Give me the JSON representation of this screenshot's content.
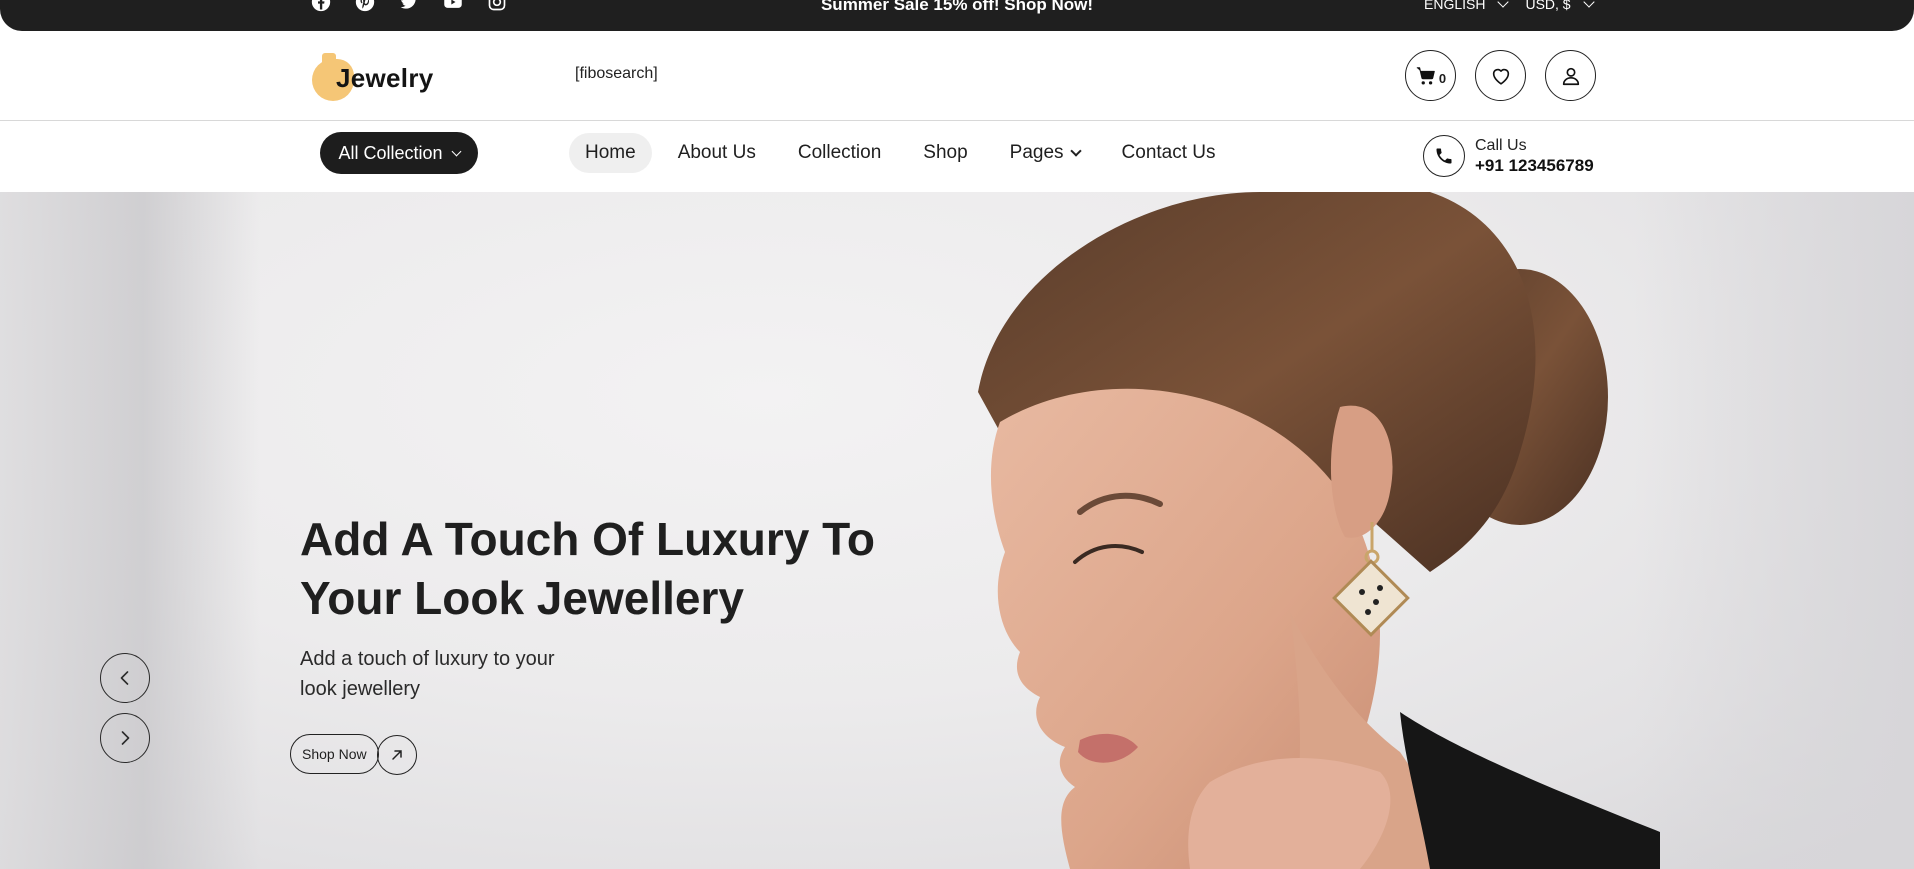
{
  "topbar": {
    "social_icons": [
      "facebook-icon",
      "pinterest-icon",
      "twitter-icon",
      "youtube-icon",
      "instagram-icon"
    ],
    "promo_text": "Summer Sale 15% off! Shop Now!",
    "language": "ENGLISH",
    "currency": "USD, $"
  },
  "header": {
    "logo_text": "Jewelry",
    "search_placeholder": "[fibosearch]",
    "cart_count": "0",
    "accent_color": "#f5c676"
  },
  "nav": {
    "all_collection_label": "All Collection",
    "items": [
      {
        "label": "Home",
        "active": true
      },
      {
        "label": "About Us"
      },
      {
        "label": "Collection"
      },
      {
        "label": "Shop"
      },
      {
        "label": "Pages",
        "has_dropdown": true
      },
      {
        "label": "Contact Us"
      }
    ],
    "call_label": "Call Us",
    "call_number": "+91 123456789"
  },
  "hero": {
    "title_line1": "Add A Touch Of Luxury To",
    "title_line2": "Your Look Jewellery",
    "subtitle_line1": "Add a touch of luxury to your",
    "subtitle_line2": "look jewellery",
    "cta_label": "Shop Now"
  }
}
